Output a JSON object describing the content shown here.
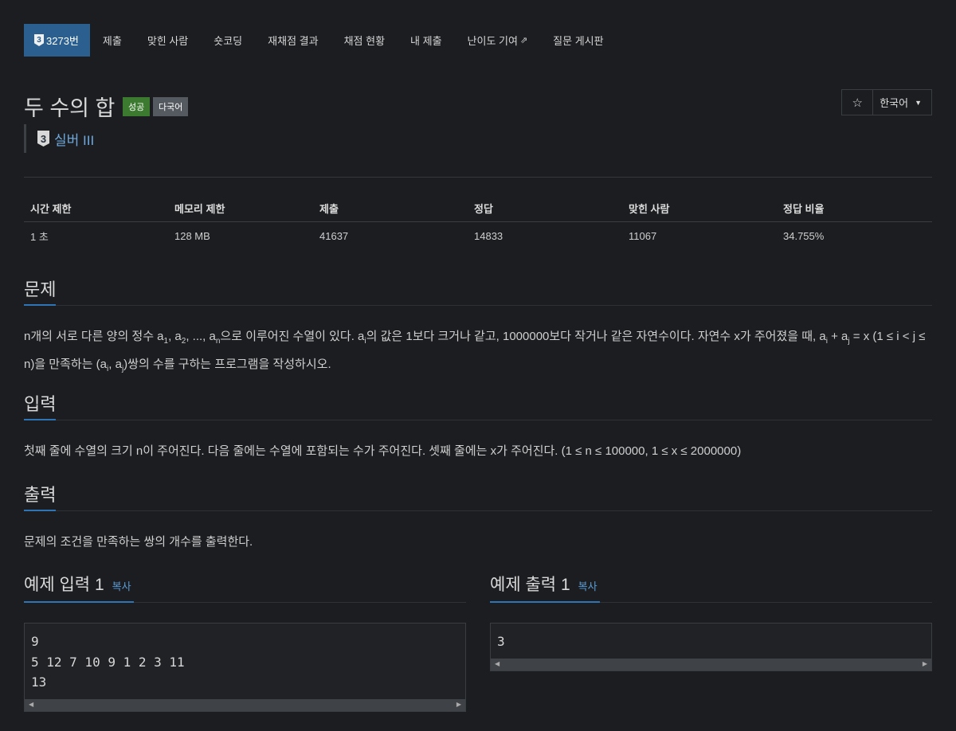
{
  "nav": {
    "problem_number": "3273번",
    "tier_num": "3",
    "items": [
      "제출",
      "맞힌 사람",
      "숏코딩",
      "재채점 결과",
      "채점 현황",
      "내 제출",
      "난이도 기여",
      "질문 게시판"
    ]
  },
  "problem": {
    "title": "두 수의 합",
    "badge_success": "성공",
    "badge_multi": "다국어",
    "tier_num": "3",
    "tier_label": "실버 III",
    "language": "한국어"
  },
  "stats": {
    "headers": [
      "시간 제한",
      "메모리 제한",
      "제출",
      "정답",
      "맞힌 사람",
      "정답 비율"
    ],
    "values": [
      "1 초",
      "128 MB",
      "41637",
      "14833",
      "11067",
      "34.755%"
    ]
  },
  "sections": {
    "problem_title": "문제",
    "input_title": "입력",
    "input_text": "첫째 줄에 수열의 크기 n이 주어진다. 다음 줄에는 수열에 포함되는 수가 주어진다. 셋째 줄에는 x가 주어진다. (1 ≤ n ≤ 100000, 1 ≤ x ≤ 2000000)",
    "output_title": "출력",
    "output_text": "문제의 조건을 만족하는 쌍의 개수를 출력한다."
  },
  "samples": {
    "input_title": "예제 입력 1",
    "output_title": "예제 출력 1",
    "copy_label": "복사",
    "input_lines": [
      "9",
      "5 12 7 10 9 1 2 3 11",
      "13"
    ],
    "output_lines": [
      "3"
    ]
  },
  "colors": {
    "accent": "#2a5f8f",
    "success": "#3b7a2f",
    "tier": "#6fa8dc"
  }
}
